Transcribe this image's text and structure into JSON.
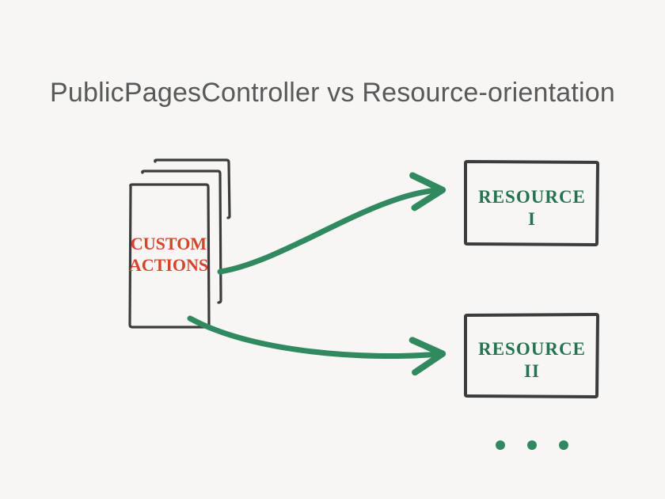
{
  "title": "PublicPagesController vs Resource-orientation",
  "stack": {
    "line1": "CUSTOM",
    "line2": "ACTIONS"
  },
  "box1": {
    "line1": "RESOURCE",
    "line2": "I"
  },
  "box2": {
    "line1": "RESOURCE",
    "line2": "II"
  },
  "ellipsis": "• • •",
  "colors": {
    "dark": "#3c3c3c",
    "arrow": "#318a5f",
    "red": "#d8432c",
    "greentext": "#25744f"
  }
}
